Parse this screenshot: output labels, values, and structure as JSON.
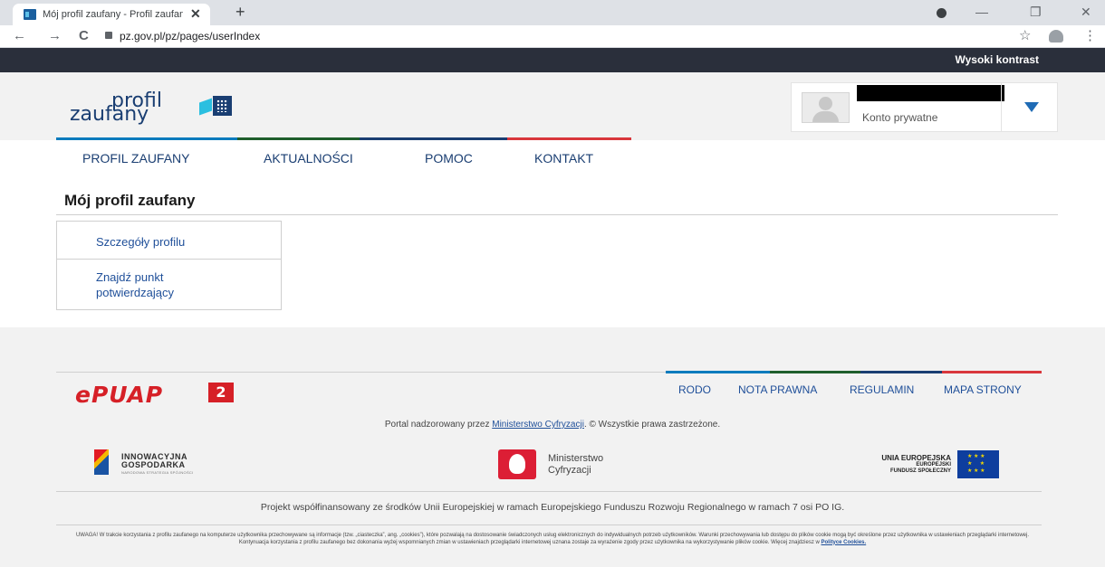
{
  "browser": {
    "tab_title": "Mój profil zaufany - Profil zaufan",
    "tab_close": "✕",
    "new_tab": "+",
    "url": "pz.gov.pl/pz/pages/userIndex",
    "back": "←",
    "forward": "→",
    "reload": "C",
    "star": "☆",
    "menu": "⋮",
    "minimize": "—",
    "restore": "❐",
    "close": "✕"
  },
  "top_strip": {
    "contrast_link": "Wysoki kontrast"
  },
  "header": {
    "logo_line1": "profil",
    "logo_line2": "zaufany",
    "account_type": "Konto prywatne"
  },
  "color_bar": [
    "#0a7bbd",
    "#1f5e2c",
    "#d9373c"
  ],
  "main_nav": {
    "items": [
      "PROFIL ZAUFANY",
      "AKTUALNOŚCI",
      "POMOC",
      "KONTAKT"
    ]
  },
  "page": {
    "title": "Mój profil zaufany",
    "side_menu": [
      "Szczegóły profilu",
      "Znajdź punkt potwierdzający"
    ]
  },
  "footer": {
    "logo_text": "ePUAP",
    "logo_badge": "2",
    "links": [
      "RODO",
      "NOTA PRAWNA",
      "REGULAMIN",
      "MAPA STRONY"
    ],
    "supervision_prefix": "Portal nadzorowany przez ",
    "supervision_link": "Ministerstwo Cyfryzacji",
    "supervision_suffix": ". © Wszystkie prawa zastrzeżone.",
    "partner_ig_line1": "INNOWACYJNA",
    "partner_ig_line2": "GOSPODARKA",
    "partner_ig_line3": "NARODOWA STRATEGIA SPÓJNOŚCI",
    "partner_mc_line1": "Ministerstwo",
    "partner_mc_line2": "Cyfryzacji",
    "partner_ue_line1": "UNIA EUROPEJSKA",
    "partner_ue_line2": "EUROPEJSKI",
    "partner_ue_line3": "FUNDUSZ SPOŁECZNY",
    "cofinance": "Projekt współfinansowany ze środków Unii Europejskiej w ramach Europejskiego Funduszu Rozwoju Regionalnego w ramach 7 osi PO IG.",
    "cookie_text": "UWAGA! W trakcie korzystania z profilu zaufanego na komputerze użytkownika przechowywane są informacje (tzw. „ciasteczka”, ang. „cookies”), które pozwalają na dostosowanie świadczonych usług elektronicznych do indywidualnych potrzeb użytkowników. Warunki przechowywania lub dostępu do plików cookie mogą być określone przez użytkownika w ustawieniach przeglądarki internetowej. Kontynuacja korzystania z profilu zaufanego bez dokonania wyżej wspomnianych zmian w ustawieniach przeglądarki internetowej uznana zostaje za wyrażenie zgody przez użytkownika na wykorzystywanie plików cookie. Więcej znajdziesz w ",
    "cookie_link": "Polityce Cookies."
  },
  "colors": {
    "brand_blue": "#1a3e72",
    "link_blue": "#1f4f99",
    "epuap_red": "#d62027",
    "dark_strip": "#2a2f3b"
  }
}
